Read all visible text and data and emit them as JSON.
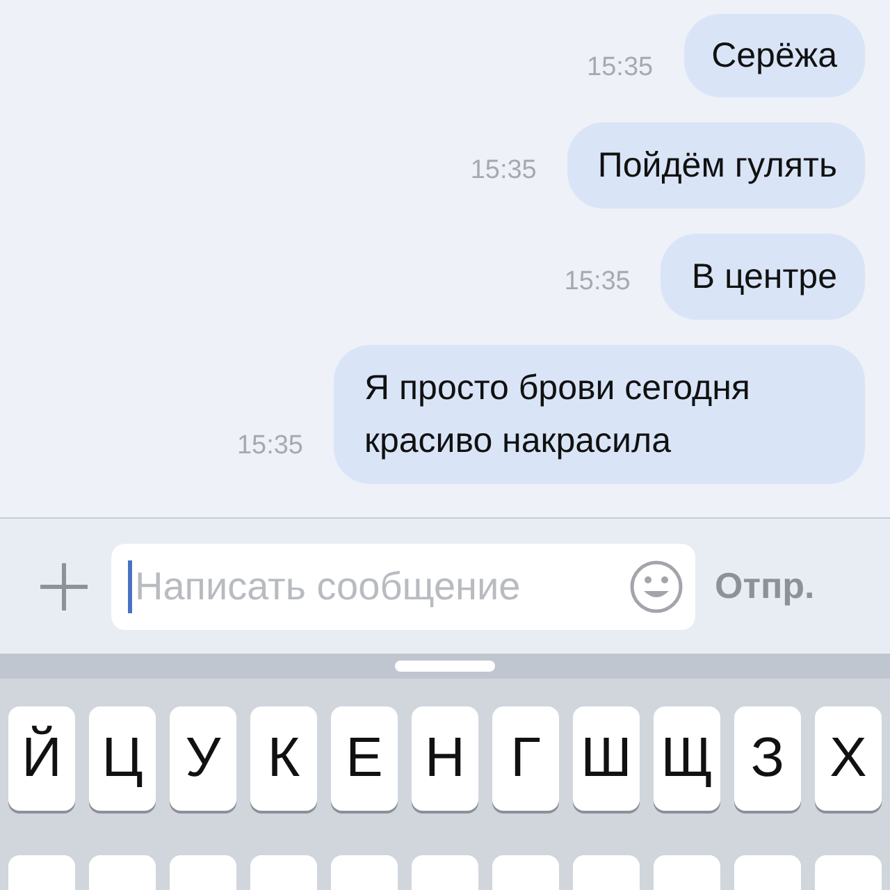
{
  "messages": [
    {
      "time": "15:35",
      "text": "Серёжа"
    },
    {
      "time": "15:35",
      "text": "Пойдём гулять"
    },
    {
      "time": "15:35",
      "text": "В центре"
    },
    {
      "time": "15:35",
      "text": "Я просто брови сегодня красиво накрасила"
    }
  ],
  "composer": {
    "placeholder": "Написать сообщение",
    "send": "Отпр."
  },
  "keyboard": {
    "rows": [
      [
        "Й",
        "Ц",
        "У",
        "К",
        "Е",
        "Н",
        "Г",
        "Ш",
        "Щ",
        "З",
        "Х"
      ],
      []
    ]
  }
}
